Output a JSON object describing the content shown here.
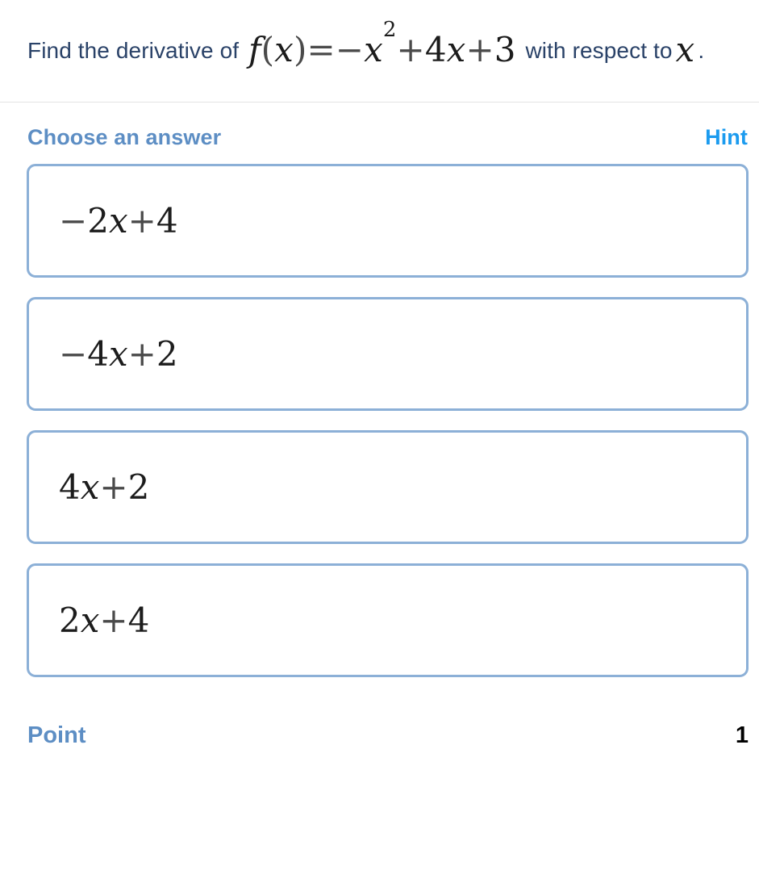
{
  "question": {
    "lead_text": "Find the derivative of",
    "formula": {
      "raw": "f(x) = -x^2 + 4x + 3",
      "fn_name": "f",
      "open_paren": "(",
      "var1": "x",
      "close_paren": ")",
      "equals": "=",
      "minus": "−",
      "var2": "x",
      "exponent": "2",
      "plus1": "+",
      "coef4": "4",
      "var3": "x",
      "plus2": "+",
      "const3": "3"
    },
    "mid_text": "with",
    "tail_text": "respect to",
    "variable": "x",
    "period": "."
  },
  "answers": {
    "choose_label": "Choose an answer",
    "hint_label": "Hint",
    "options": [
      {
        "raw": "-2x + 4",
        "minus": "−",
        "coef": "2",
        "var": "x",
        "plus": "+",
        "const": "4"
      },
      {
        "raw": "-4x + 2",
        "minus": "−",
        "coef": "4",
        "var": "x",
        "plus": "+",
        "const": "2"
      },
      {
        "raw": "4x + 2",
        "minus": "",
        "coef": "4",
        "var": "x",
        "plus": "+",
        "const": "2"
      },
      {
        "raw": "2x + 4",
        "minus": "",
        "coef": "2",
        "var": "x",
        "plus": "+",
        "const": "4"
      }
    ]
  },
  "footer": {
    "point_label": "Point",
    "point_value": "1"
  },
  "colors": {
    "question_text": "#2a4268",
    "choose_label": "#5d8ec4",
    "hint": "#1b9bef",
    "option_border": "#8cb0d7",
    "divider": "#e3e3e3",
    "math": "#1c1c1c",
    "point_value": "#000000"
  }
}
